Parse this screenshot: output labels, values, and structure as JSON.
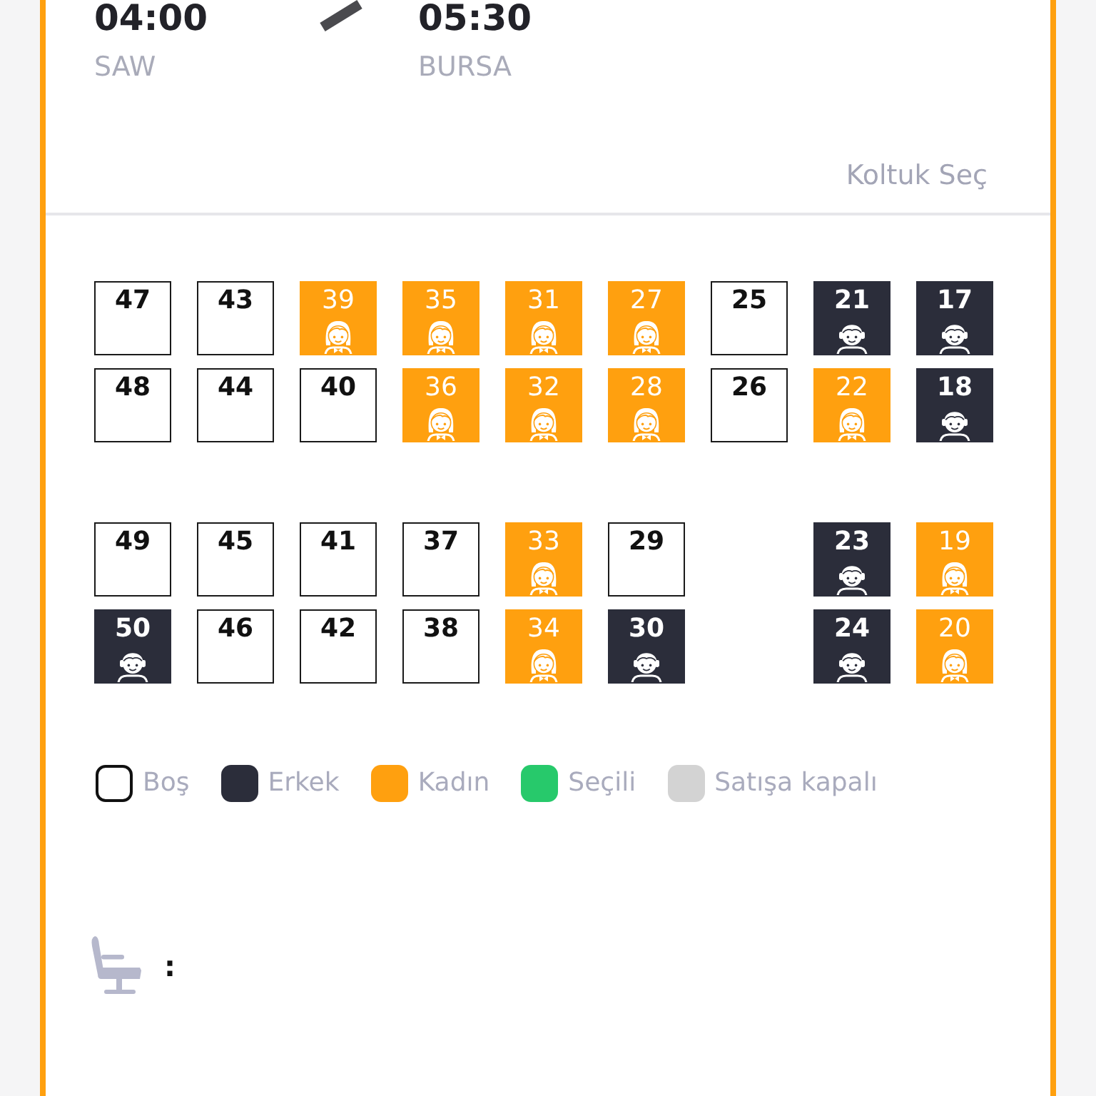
{
  "trip": {
    "departure": {
      "time": "04:00",
      "place": "SAW"
    },
    "arrival": {
      "time": "05:30",
      "place": "BURSA"
    }
  },
  "seat_select_label": "Koltuk Seç",
  "seat_groups": [
    {
      "rows": [
        {
          "cells": [
            {
              "kind": "empty",
              "number": "47",
              "selected": false
            },
            {
              "kind": "empty",
              "number": "43",
              "selected": false
            },
            {
              "kind": "female",
              "number": "39",
              "selected": false
            },
            {
              "kind": "female",
              "number": "35",
              "selected": false
            },
            {
              "kind": "female",
              "number": "31",
              "selected": false
            },
            {
              "kind": "female",
              "number": "27",
              "selected": false
            },
            {
              "kind": "empty",
              "number": "25",
              "selected": false
            },
            {
              "kind": "male",
              "number": "21",
              "selected": false
            },
            {
              "kind": "male",
              "number": "17",
              "selected": false
            }
          ]
        },
        {
          "cells": [
            {
              "kind": "empty",
              "number": "48",
              "selected": false
            },
            {
              "kind": "empty",
              "number": "44",
              "selected": false
            },
            {
              "kind": "empty",
              "number": "40",
              "selected": false
            },
            {
              "kind": "female",
              "number": "36",
              "selected": false
            },
            {
              "kind": "female",
              "number": "32",
              "selected": false
            },
            {
              "kind": "female",
              "number": "28",
              "selected": false
            },
            {
              "kind": "empty",
              "number": "26",
              "selected": false
            },
            {
              "kind": "female",
              "number": "22",
              "selected": false
            },
            {
              "kind": "male",
              "number": "18",
              "selected": false
            }
          ]
        }
      ]
    },
    {
      "rows": [
        {
          "cells": [
            {
              "kind": "empty",
              "number": "49",
              "selected": false
            },
            {
              "kind": "empty",
              "number": "45",
              "selected": false
            },
            {
              "kind": "empty",
              "number": "41",
              "selected": false
            },
            {
              "kind": "empty",
              "number": "37",
              "selected": false
            },
            {
              "kind": "female",
              "number": "33",
              "selected": false
            },
            {
              "kind": "empty",
              "number": "29",
              "selected": false
            },
            {
              "kind": "space"
            },
            {
              "kind": "male",
              "number": "23",
              "selected": false
            },
            {
              "kind": "female",
              "number": "19",
              "selected": false
            }
          ]
        },
        {
          "cells": [
            {
              "kind": "male",
              "number": "50",
              "selected": false
            },
            {
              "kind": "empty",
              "number": "46",
              "selected": false
            },
            {
              "kind": "empty",
              "number": "42",
              "selected": false
            },
            {
              "kind": "empty",
              "number": "38",
              "selected": false
            },
            {
              "kind": "female",
              "number": "34",
              "selected": false
            },
            {
              "kind": "male",
              "number": "30",
              "selected": false
            },
            {
              "kind": "space"
            },
            {
              "kind": "male",
              "number": "24",
              "selected": false
            },
            {
              "kind": "female",
              "number": "20",
              "selected": false
            }
          ]
        }
      ]
    }
  ],
  "legend": [
    {
      "label": "Boş",
      "color": "#ffffff",
      "outlined": true
    },
    {
      "label": "Erkek",
      "color": "#2b2d3a",
      "outlined": false
    },
    {
      "label": "Kadın",
      "color": "#ffa00f",
      "outlined": false
    },
    {
      "label": "Seçili",
      "color": "#27c96b",
      "outlined": false
    },
    {
      "label": "Satışa kapalı",
      "color": "#d3d3d3",
      "outlined": false
    }
  ],
  "selected_seats": {
    "separator": ":"
  }
}
